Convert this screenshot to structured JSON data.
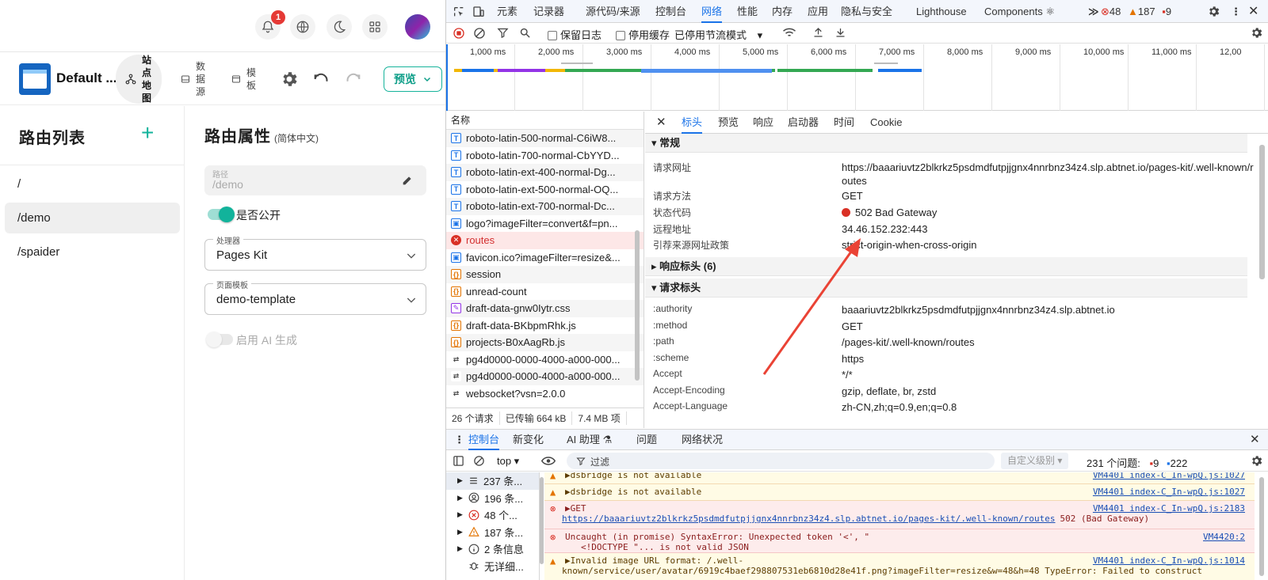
{
  "app": {
    "notification_count": "1",
    "site_title": "Default ...",
    "tabs": [
      {
        "label": "站点地图"
      },
      {
        "label": "数据源"
      },
      {
        "label": "模板"
      }
    ],
    "preview_label": "预览",
    "routes": {
      "title": "路由列表",
      "add": "+",
      "items": [
        "/",
        "/demo",
        "/spaider"
      ]
    },
    "props": {
      "title": "路由属性",
      "locale": "(简体中文)",
      "path_label": "路径",
      "path_value": "/demo",
      "public_label": "是否公开",
      "handler_label": "处理器",
      "handler_value": "Pages Kit",
      "template_label": "页面模板",
      "template_value": "demo-template",
      "ai_label": "启用 AI 生成"
    },
    "accent_color": "#12b39b"
  },
  "devtools": {
    "tabs": [
      "元素",
      "记录器",
      "源代码/来源",
      "控制台",
      "网络",
      "性能",
      "内存",
      "应用",
      "隐私与安全",
      "Lighthouse",
      "Components ⚛"
    ],
    "more": "≫",
    "errors": "48",
    "warnings": "187",
    "infos": "9",
    "network_toolbar": {
      "preserve_log": "保留日志",
      "disable_cache": "停用缓存",
      "throttle": "已停用节流模式"
    },
    "timeline_labels": [
      "1,000 ms",
      "2,000 ms",
      "3,000 ms",
      "4,000 ms",
      "5,000 ms",
      "6,000 ms",
      "7,000 ms",
      "8,000 ms",
      "9,000 ms",
      "10,000 ms",
      "11,000 ms",
      "12,00"
    ],
    "request_list_header": "名称",
    "requests": [
      {
        "name": "roboto-latin-500-normal-C6iW8...",
        "type": "font"
      },
      {
        "name": "roboto-latin-700-normal-CbYYD...",
        "type": "font"
      },
      {
        "name": "roboto-latin-ext-400-normal-Dg...",
        "type": "font"
      },
      {
        "name": "roboto-latin-ext-500-normal-OQ...",
        "type": "font"
      },
      {
        "name": "roboto-latin-ext-700-normal-Dc...",
        "type": "font"
      },
      {
        "name": "logo?imageFilter=convert&f=pn...",
        "type": "img"
      },
      {
        "name": "routes",
        "type": "error"
      },
      {
        "name": "favicon.ico?imageFilter=resize&...",
        "type": "img"
      },
      {
        "name": "session",
        "type": "fetch"
      },
      {
        "name": "unread-count",
        "type": "fetch"
      },
      {
        "name": "draft-data-gnw0Iytr.css",
        "type": "css"
      },
      {
        "name": "draft-data-BKbpmRhk.js",
        "type": "js"
      },
      {
        "name": "projects-B0xAagRb.js",
        "type": "js"
      },
      {
        "name": "pg4d0000-0000-4000-a000-000...",
        "type": "ws"
      },
      {
        "name": "pg4d0000-0000-4000-a000-000...",
        "type": "ws"
      },
      {
        "name": "websocket?vsn=2.0.0",
        "type": "ws"
      }
    ],
    "summary": [
      "26 个请求",
      "已传输 664 kB",
      "7.4 MB 项"
    ],
    "detail_tabs": [
      "标头",
      "预览",
      "响应",
      "启动器",
      "时间",
      "Cookie"
    ],
    "general_title": "常规",
    "general": [
      {
        "k": "请求网址",
        "v": "https://baaariuvtz2blkrkz5psdmdfutpjjgnx4nnrbnz34z4.slp.abtnet.io/pages-kit/.well-known/routes"
      },
      {
        "k": "请求方法",
        "v": "GET"
      },
      {
        "k": "状态代码",
        "v": "502 Bad Gateway"
      },
      {
        "k": "远程地址",
        "v": "34.46.152.232:443"
      },
      {
        "k": "引荐来源网址政策",
        "v": "strict-origin-when-cross-origin"
      }
    ],
    "response_headers_title": "响应标头 (6)",
    "request_headers_title": "请求标头",
    "request_headers": [
      {
        "k": ":authority",
        "v": "baaariuvtz2blkrkz5psdmdfutpjjgnx4nnrbnz34z4.slp.abtnet.io"
      },
      {
        "k": ":method",
        "v": "GET"
      },
      {
        "k": ":path",
        "v": "/pages-kit/.well-known/routes"
      },
      {
        "k": ":scheme",
        "v": "https"
      },
      {
        "k": "Accept",
        "v": "*/*"
      },
      {
        "k": "Accept-Encoding",
        "v": "gzip, deflate, br, zstd"
      },
      {
        "k": "Accept-Language",
        "v": "zh-CN,zh;q=0.9,en;q=0.8"
      }
    ],
    "console_tabs": [
      "控制台",
      "新变化",
      "AI 助理 ⚗",
      "问题",
      "网络状况"
    ],
    "console_toolbar": {
      "context": "top ▾",
      "filter_placeholder": "过滤",
      "levels": "自定义级别 ▾",
      "issues": "231 个问题:",
      "issue_errors": "9",
      "issue_infos": "222"
    },
    "console_sidebar": [
      {
        "label": "237 条...",
        "icon": "list"
      },
      {
        "label": "196 条...",
        "icon": "user"
      },
      {
        "label": "48 个...",
        "icon": "error"
      },
      {
        "label": "187 条...",
        "icon": "warning"
      },
      {
        "label": "2 条信息",
        "icon": "info"
      },
      {
        "label": "无详细...",
        "icon": "bug"
      }
    ],
    "console_messages": [
      {
        "level": "warn",
        "text": "▶dsbridge is not available",
        "src": "VM4401 index-C_In-wpQ.js:1027"
      },
      {
        "level": "warn",
        "text": "▶dsbridge is not available",
        "src": "VM4401 index-C_In-wpQ.js:1027"
      },
      {
        "level": "err",
        "text": "▶GET",
        "link": "https://baaariuvtz2blkrkz5psdmdfutpjjgnx4nnrbnz34z4.slp.abtnet.io/pages-kit/.well-known/routes",
        "status": "502 (Bad Gateway)",
        "src": "VM4401 index-C_In-wpQ.js:2183"
      },
      {
        "level": "err",
        "text": "Uncaught (in promise) SyntaxError: Unexpected token '<', \"",
        "text2": "<!DOCTYPE \"... is not valid JSON",
        "src": "VM4420:2"
      },
      {
        "level": "warn",
        "text": "▶Invalid image URL format: /.well-",
        "text2": "known/service/user/avatar/6919c4baef298807531eb6810d28e41f.png?imageFilter=resize&w=48&h=48 TypeError: Failed to construct",
        "src": "VM4401 index-C_In-wpQ.js:1014"
      }
    ]
  }
}
